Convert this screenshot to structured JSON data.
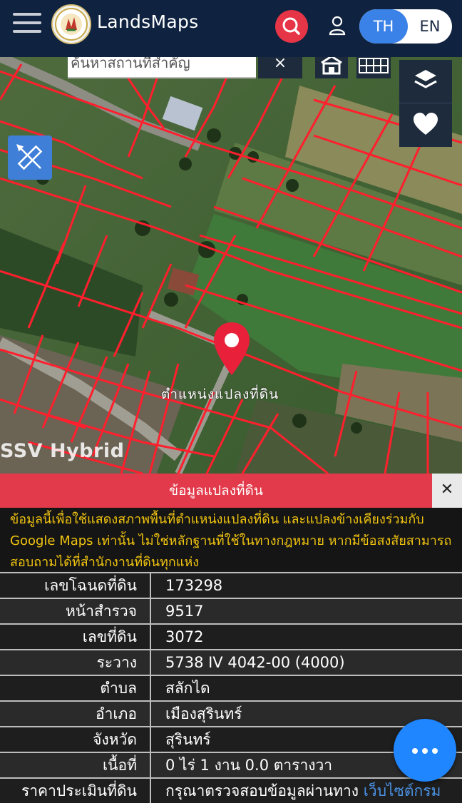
{
  "header": {
    "app_name": "LandsMaps",
    "lang_active": "TH",
    "lang_other": "EN",
    "bg_color": "#0f2340"
  },
  "map": {
    "search_placeholder": "ค้นหาสถานที่สำคัญ",
    "clear_label": "×",
    "parcel_label": "ตำแหน่งแปลงที่ดิน",
    "layer_label": "SSV Hybrid",
    "parcel_line_color": "#ff1f2d",
    "pin_color": "#e8203a"
  },
  "panel": {
    "title": "ข้อมูลแปลงที่ดิน",
    "close_label": "✕",
    "disclaimer": "ข้อมูลนี้เพื่อใช้แสดงสภาพพื้นที่ตำแหน่งแปลงที่ดิน และแปลงข้างเคียงร่วมกับ Google Maps เท่านั้น ไม่ใช่หลักฐานที่ใช้ในทางกฎหมาย หากมีข้อสงสัยสามารถสอบถามได้ที่สำนักงานที่ดินทุกแห่ง",
    "rows": [
      {
        "label": "เลขโฉนดที่ดิน",
        "value": "173298"
      },
      {
        "label": "หน้าสำรวจ",
        "value": "9517"
      },
      {
        "label": "เลขที่ดิน",
        "value": "3072"
      },
      {
        "label": "ระวาง",
        "value": "5738 IV 4042-00 (4000)"
      },
      {
        "label": "ตำบล",
        "value": "สลักได"
      },
      {
        "label": "อำเภอ",
        "value": "เมืองสุรินทร์"
      },
      {
        "label": "จังหวัด",
        "value": "สุรินทร์"
      },
      {
        "label": "เนื้อที่",
        "value": "0 ไร่ 1 งาน 0.0 ตารางวา"
      },
      {
        "label": "ราคาประเมินที่ดิน",
        "value": "กรุณาตรวจสอบข้อมูลผ่านทาง",
        "link": "เว็บไซต์กรม"
      }
    ],
    "title_color": "#e23a4a",
    "disclaimer_color": "#f1c40f"
  }
}
